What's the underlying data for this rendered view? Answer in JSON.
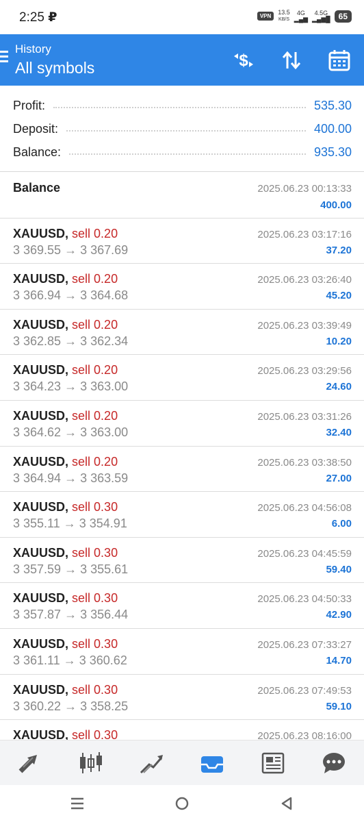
{
  "status_bar": {
    "time": "2:25",
    "carrier_glyph": "₽",
    "vpn": "VPN",
    "speed": "13.5",
    "speed_unit": "KB/S",
    "net1": "4G",
    "net2": "4.5G",
    "battery": "65"
  },
  "header": {
    "subtitle": "History",
    "title": "All symbols",
    "icons": [
      "currency-exchange-icon",
      "sort-icon",
      "calendar-icon"
    ],
    "color": "#2f86e6"
  },
  "summary": [
    {
      "label": "Profit:",
      "value": "535.30"
    },
    {
      "label": "Deposit:",
      "value": "400.00"
    },
    {
      "label": "Balance:",
      "value": "935.30"
    }
  ],
  "balance_entry": {
    "label": "Balance",
    "time": "2025.06.23 00:13:33",
    "amount": "400.00"
  },
  "deals": [
    {
      "symbol": "XAUUSD,",
      "side": "sell 0.20",
      "open": "3 369.55",
      "close": "3 367.69",
      "time": "2025.06.23 03:17:16",
      "profit": "37.20"
    },
    {
      "symbol": "XAUUSD,",
      "side": "sell 0.20",
      "open": "3 366.94",
      "close": "3 364.68",
      "time": "2025.06.23 03:26:40",
      "profit": "45.20"
    },
    {
      "symbol": "XAUUSD,",
      "side": "sell 0.20",
      "open": "3 362.85",
      "close": "3 362.34",
      "time": "2025.06.23 03:39:49",
      "profit": "10.20"
    },
    {
      "symbol": "XAUUSD,",
      "side": "sell 0.20",
      "open": "3 364.23",
      "close": "3 363.00",
      "time": "2025.06.23 03:29:56",
      "profit": "24.60"
    },
    {
      "symbol": "XAUUSD,",
      "side": "sell 0.20",
      "open": "3 364.62",
      "close": "3 363.00",
      "time": "2025.06.23 03:31:26",
      "profit": "32.40"
    },
    {
      "symbol": "XAUUSD,",
      "side": "sell 0.20",
      "open": "3 364.94",
      "close": "3 363.59",
      "time": "2025.06.23 03:38:50",
      "profit": "27.00"
    },
    {
      "symbol": "XAUUSD,",
      "side": "sell 0.30",
      "open": "3 355.11",
      "close": "3 354.91",
      "time": "2025.06.23 04:56:08",
      "profit": "6.00"
    },
    {
      "symbol": "XAUUSD,",
      "side": "sell 0.30",
      "open": "3 357.59",
      "close": "3 355.61",
      "time": "2025.06.23 04:45:59",
      "profit": "59.40"
    },
    {
      "symbol": "XAUUSD,",
      "side": "sell 0.30",
      "open": "3 357.87",
      "close": "3 356.44",
      "time": "2025.06.23 04:50:33",
      "profit": "42.90"
    },
    {
      "symbol": "XAUUSD,",
      "side": "sell 0.30",
      "open": "3 361.11",
      "close": "3 360.62",
      "time": "2025.06.23 07:33:27",
      "profit": "14.70"
    },
    {
      "symbol": "XAUUSD,",
      "side": "sell 0.30",
      "open": "3 360.22",
      "close": "3 358.25",
      "time": "2025.06.23 07:49:53",
      "profit": "59.10"
    },
    {
      "symbol": "XAUUSD,",
      "side": "sell 0.30",
      "open": "",
      "close": "",
      "time": "2025.06.23 08:16:00",
      "profit": ""
    }
  ],
  "arrow": "→",
  "bottom_nav": [
    "quotes-icon",
    "chart-icon",
    "trade-icon",
    "history-icon",
    "news-icon",
    "chat-icon"
  ],
  "active_tab": "history-icon",
  "colors": {
    "accent": "#2f86e6",
    "profit": "#1d74d6",
    "sell": "#c62828",
    "muted": "#8a8a8a"
  }
}
